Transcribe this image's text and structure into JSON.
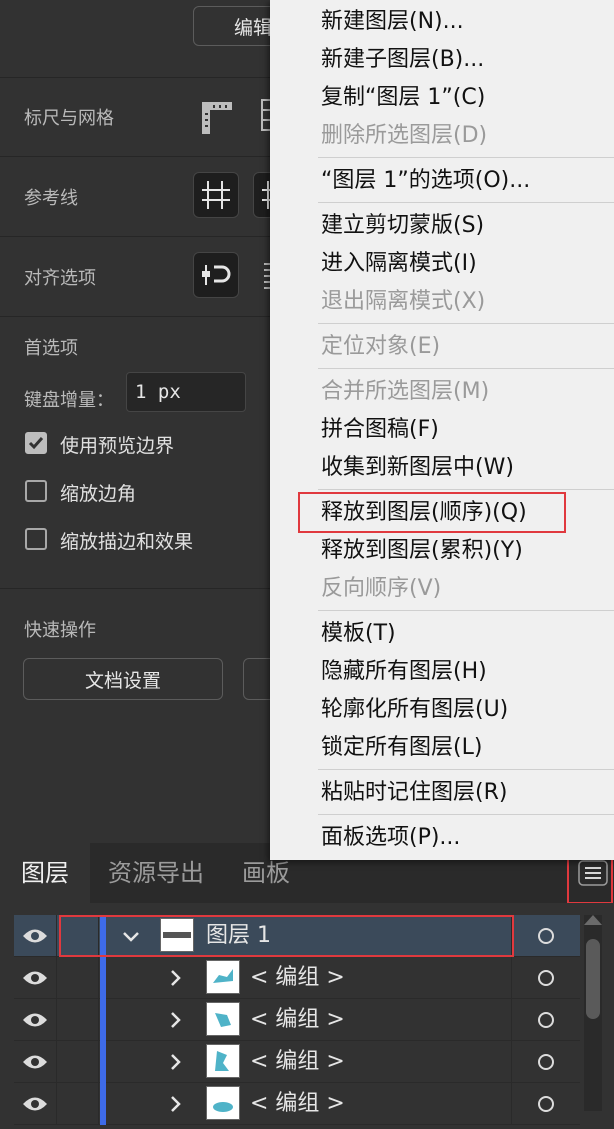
{
  "properties_panel": {
    "edit_button_label": "编辑",
    "rulers_grid_label": "标尺与网格",
    "guides_label": "参考线",
    "align_options_label": "对齐选项",
    "preferences_label": "首选项",
    "keyboard_increment_label": "键盘增量：",
    "keyboard_increment_value": "1 px",
    "checkboxes": [
      {
        "label": "使用预览边界",
        "checked": true
      },
      {
        "label": "缩放边角",
        "checked": false
      },
      {
        "label": "缩放描边和效果",
        "checked": false
      }
    ],
    "quick_actions_label": "快速操作",
    "document_setup_label": "文档设置"
  },
  "context_menu": {
    "items": [
      {
        "label": "新建图层(N)...",
        "enabled": true
      },
      {
        "label": "新建子图层(B)...",
        "enabled": true
      },
      {
        "label": "复制“图层 1”(C)",
        "enabled": true
      },
      {
        "label": "删除所选图层(D)",
        "enabled": false
      },
      {
        "label": "“图层 1”的选项(O)...",
        "enabled": true
      },
      {
        "label": "建立剪切蒙版(S)",
        "enabled": true
      },
      {
        "label": "进入隔离模式(I)",
        "enabled": true
      },
      {
        "label": "退出隔离模式(X)",
        "enabled": false
      },
      {
        "label": "定位对象(E)",
        "enabled": false
      },
      {
        "label": "合并所选图层(M)",
        "enabled": false
      },
      {
        "label": "拼合图稿(F)",
        "enabled": true
      },
      {
        "label": "收集到新图层中(W)",
        "enabled": true
      },
      {
        "label": "释放到图层(顺序)(Q)",
        "enabled": true,
        "highlighted": true
      },
      {
        "label": "释放到图层(累积)(Y)",
        "enabled": true
      },
      {
        "label": "反向顺序(V)",
        "enabled": false
      },
      {
        "label": "模板(T)",
        "enabled": true
      },
      {
        "label": "隐藏所有图层(H)",
        "enabled": true
      },
      {
        "label": "轮廓化所有图层(U)",
        "enabled": true
      },
      {
        "label": "锁定所有图层(L)",
        "enabled": true
      },
      {
        "label": "粘贴时记住图层(R)",
        "enabled": true
      },
      {
        "label": "面板选项(P)...",
        "enabled": true
      }
    ]
  },
  "layers_panel": {
    "tabs": [
      "图层",
      "资源导出",
      "画板"
    ],
    "active_tab": 0,
    "menu_icon": "hamburger-menu-icon",
    "layers": [
      {
        "name": "图层  1",
        "expanded": true,
        "selected": true
      },
      {
        "name": "< 编组 >",
        "expanded": false
      },
      {
        "name": "< 编组 >",
        "expanded": false
      },
      {
        "name": "< 编组 >",
        "expanded": false
      },
      {
        "name": "< 编组 >",
        "expanded": false
      }
    ],
    "layer_color": "#3e6be8"
  },
  "highlight_color": "#e0393e"
}
